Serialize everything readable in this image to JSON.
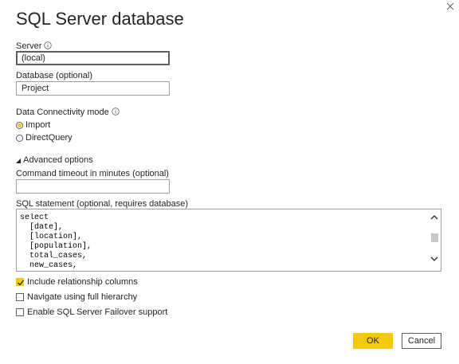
{
  "dialog": {
    "title": "SQL Server database",
    "close_icon": "close-icon"
  },
  "server": {
    "label": "Server",
    "value": "(local)"
  },
  "database": {
    "label": "Database (optional)",
    "value": "Project"
  },
  "connectivity": {
    "label": "Data Connectivity mode",
    "options": [
      {
        "label": "Import",
        "selected": true
      },
      {
        "label": "DirectQuery",
        "selected": false
      }
    ]
  },
  "advanced": {
    "toggle_label": "Advanced options",
    "timeout_label": "Command timeout in minutes (optional)",
    "timeout_value": "",
    "sql_label": "SQL statement (optional, requires database)",
    "sql_text": "select\n  [date],\n  [location],\n  [population],\n  total_cases,\n  new_cases,",
    "checkboxes": [
      {
        "label": "Include relationship columns",
        "checked": true
      },
      {
        "label": "Navigate using full hierarchy",
        "checked": false
      },
      {
        "label": "Enable SQL Server Failover support",
        "checked": false
      }
    ]
  },
  "buttons": {
    "ok_label": "OK",
    "cancel_label": "Cancel"
  },
  "colors": {
    "accent": "#f2c811",
    "text": "#252423",
    "border": "#a19f9d"
  }
}
